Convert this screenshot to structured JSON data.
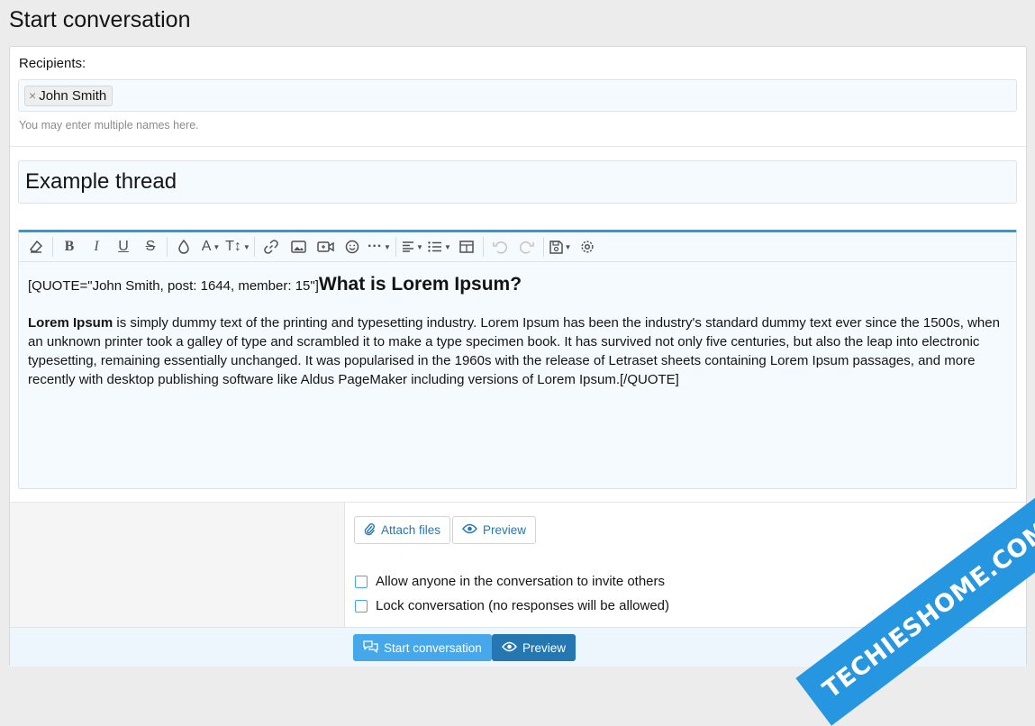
{
  "page": {
    "title": "Start conversation"
  },
  "recipients": {
    "label": "Recipients:",
    "tokens": [
      {
        "name": "John Smith",
        "remove_glyph": "×"
      }
    ],
    "hint": "You may enter multiple names here."
  },
  "thread_title": {
    "value": "Example thread"
  },
  "toolbar": {
    "items": [
      "eraser-icon",
      "bold-icon",
      "italic-icon",
      "underline-icon",
      "strikethrough-icon",
      "text-color-icon",
      "font-family-icon",
      "font-size-icon",
      "link-icon",
      "image-icon",
      "media-icon",
      "emoji-icon",
      "more-icon",
      "align-icon",
      "list-icon",
      "table-icon",
      "undo-icon",
      "redo-icon",
      "drafts-icon",
      "settings-icon"
    ]
  },
  "editor": {
    "quote_open": "[QUOTE=\"John Smith, post: 1644, member: 15\"]",
    "heading": "What is Lorem Ipsum?",
    "bold_lead": "Lorem Ipsum",
    "body": " is simply dummy text of the printing and typesetting industry. Lorem Ipsum has been the industry's standard dummy text ever since the 1500s, when an unknown printer took a galley of type and scrambled it to make a type specimen book. It has survived not only five centuries, but also the leap into electronic typesetting, remaining essentially unchanged. It was popularised in the 1960s with the release of Letraset sheets containing Lorem Ipsum passages, and more recently with desktop publishing software like Aldus PageMaker including versions of Lorem Ipsum.",
    "quote_close": "[/QUOTE]"
  },
  "attachments": {
    "attach_label": "Attach files",
    "preview_label": "Preview"
  },
  "options": [
    {
      "label": "Allow anyone in the conversation to invite others",
      "checked": false
    },
    {
      "label": "Lock conversation (no responses will be allowed)",
      "checked": false
    }
  ],
  "footer": {
    "submit_label": "Start conversation",
    "preview_label": "Preview"
  },
  "watermark": {
    "part1": "TECHIES",
    "part2": "HOME.COM"
  },
  "colors": {
    "accent": "#2d9bd7",
    "primary_button": "#47a7eb",
    "preview_button": "#2577b1",
    "link_text": "#2577b1"
  }
}
